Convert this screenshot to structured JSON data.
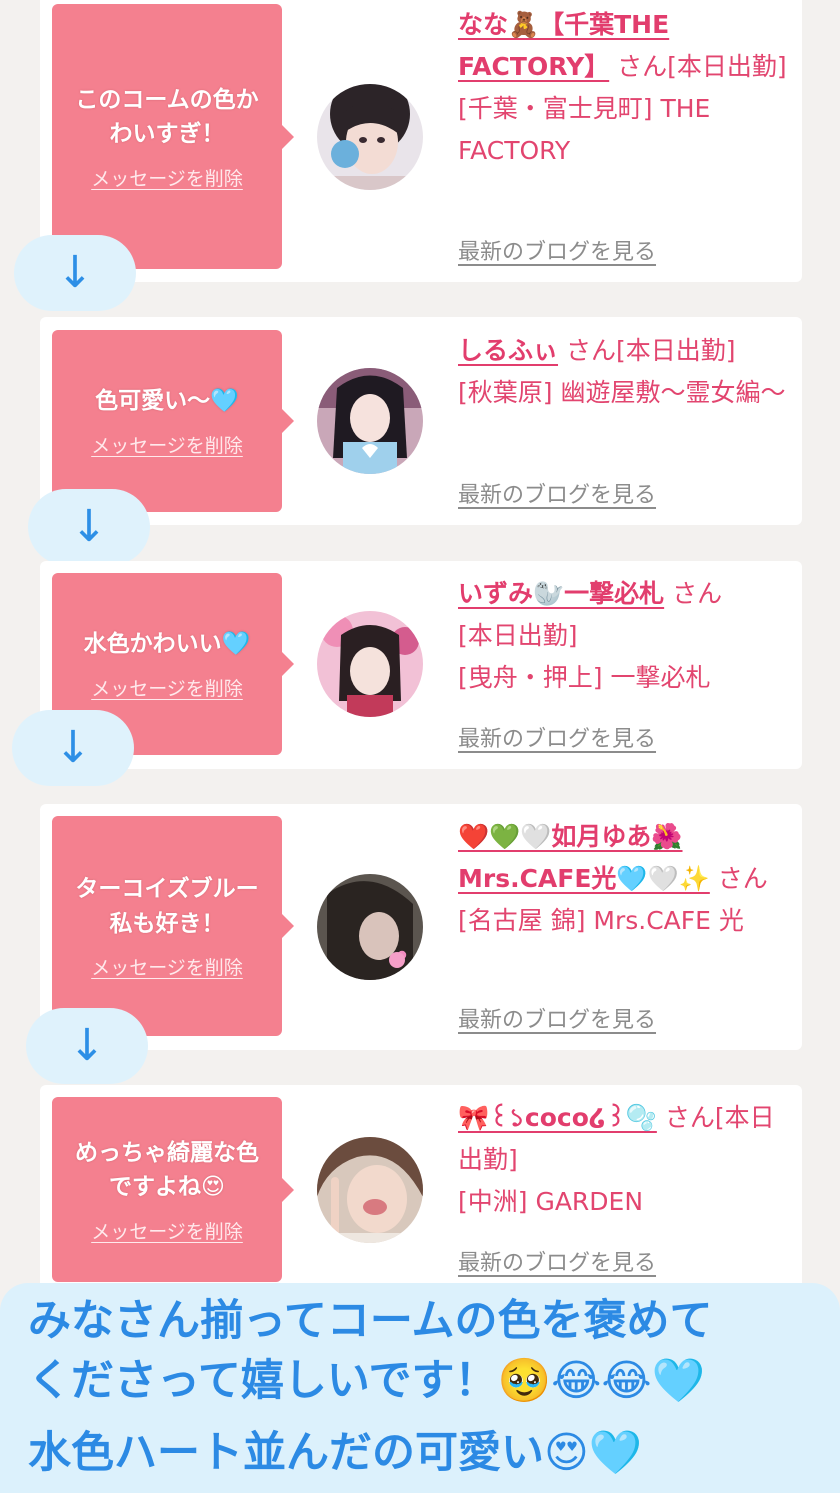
{
  "delete_label": "メッセージを削除",
  "blog_label": "最新のブログを見る",
  "arrow_glyph": "↓",
  "colors": {
    "pink_bubble": "#f4808f",
    "name_pink": "#e23d6d",
    "caption_blue": "#2c8ae4",
    "caption_bg": "#dcf1fc"
  },
  "messages": [
    {
      "text_line1": "このコームの色か",
      "text_line2": "わいすぎ！",
      "name": "なな🧸【千葉THE FACTORY】",
      "suffix": "さん[本日出勤]",
      "area": "[千葉・富士見町] THE FACTORY",
      "avatar_icon": "avatar-girl-1"
    },
    {
      "text_line1": "色可愛い〜🩵",
      "text_line2": "",
      "name": "しるふぃ",
      "suffix": "さん[本日出勤]",
      "area": "[秋葉原] 幽遊屋敷〜霊女編〜",
      "avatar_icon": "avatar-girl-2"
    },
    {
      "text_line1": "水色かわいい🩵",
      "text_line2": "",
      "name": "いずみ🦭一撃必札",
      "suffix": "さん",
      "area_line1": "[本日出勤]",
      "area": "[曳舟・押上] 一撃必札",
      "avatar_icon": "avatar-girl-3"
    },
    {
      "text_line1": "ターコイズブルー",
      "text_line2": "私も好き！",
      "name": "❤️💚🤍如月ゆあ🌺Mrs.CAFE光🩵🤍✨",
      "suffix": "さん",
      "area": "[名古屋 錦] Mrs.CAFE 光",
      "avatar_icon": "avatar-girl-4"
    },
    {
      "text_line1": "めっちゃ綺麗な色",
      "text_line2": "ですよね😍",
      "name": "🎀꒰১coco໒꒱🫧",
      "suffix": "さん[本日出勤]",
      "area": "[中洲] GARDEN",
      "avatar_icon": "avatar-girl-5"
    }
  ],
  "caption": {
    "line1": "みなさん揃ってコームの色を褒めて",
    "line2": "くださって嬉しいです！🥹😂😂🩵",
    "line3": "水色ハート並んだの可愛い😍🩵"
  }
}
